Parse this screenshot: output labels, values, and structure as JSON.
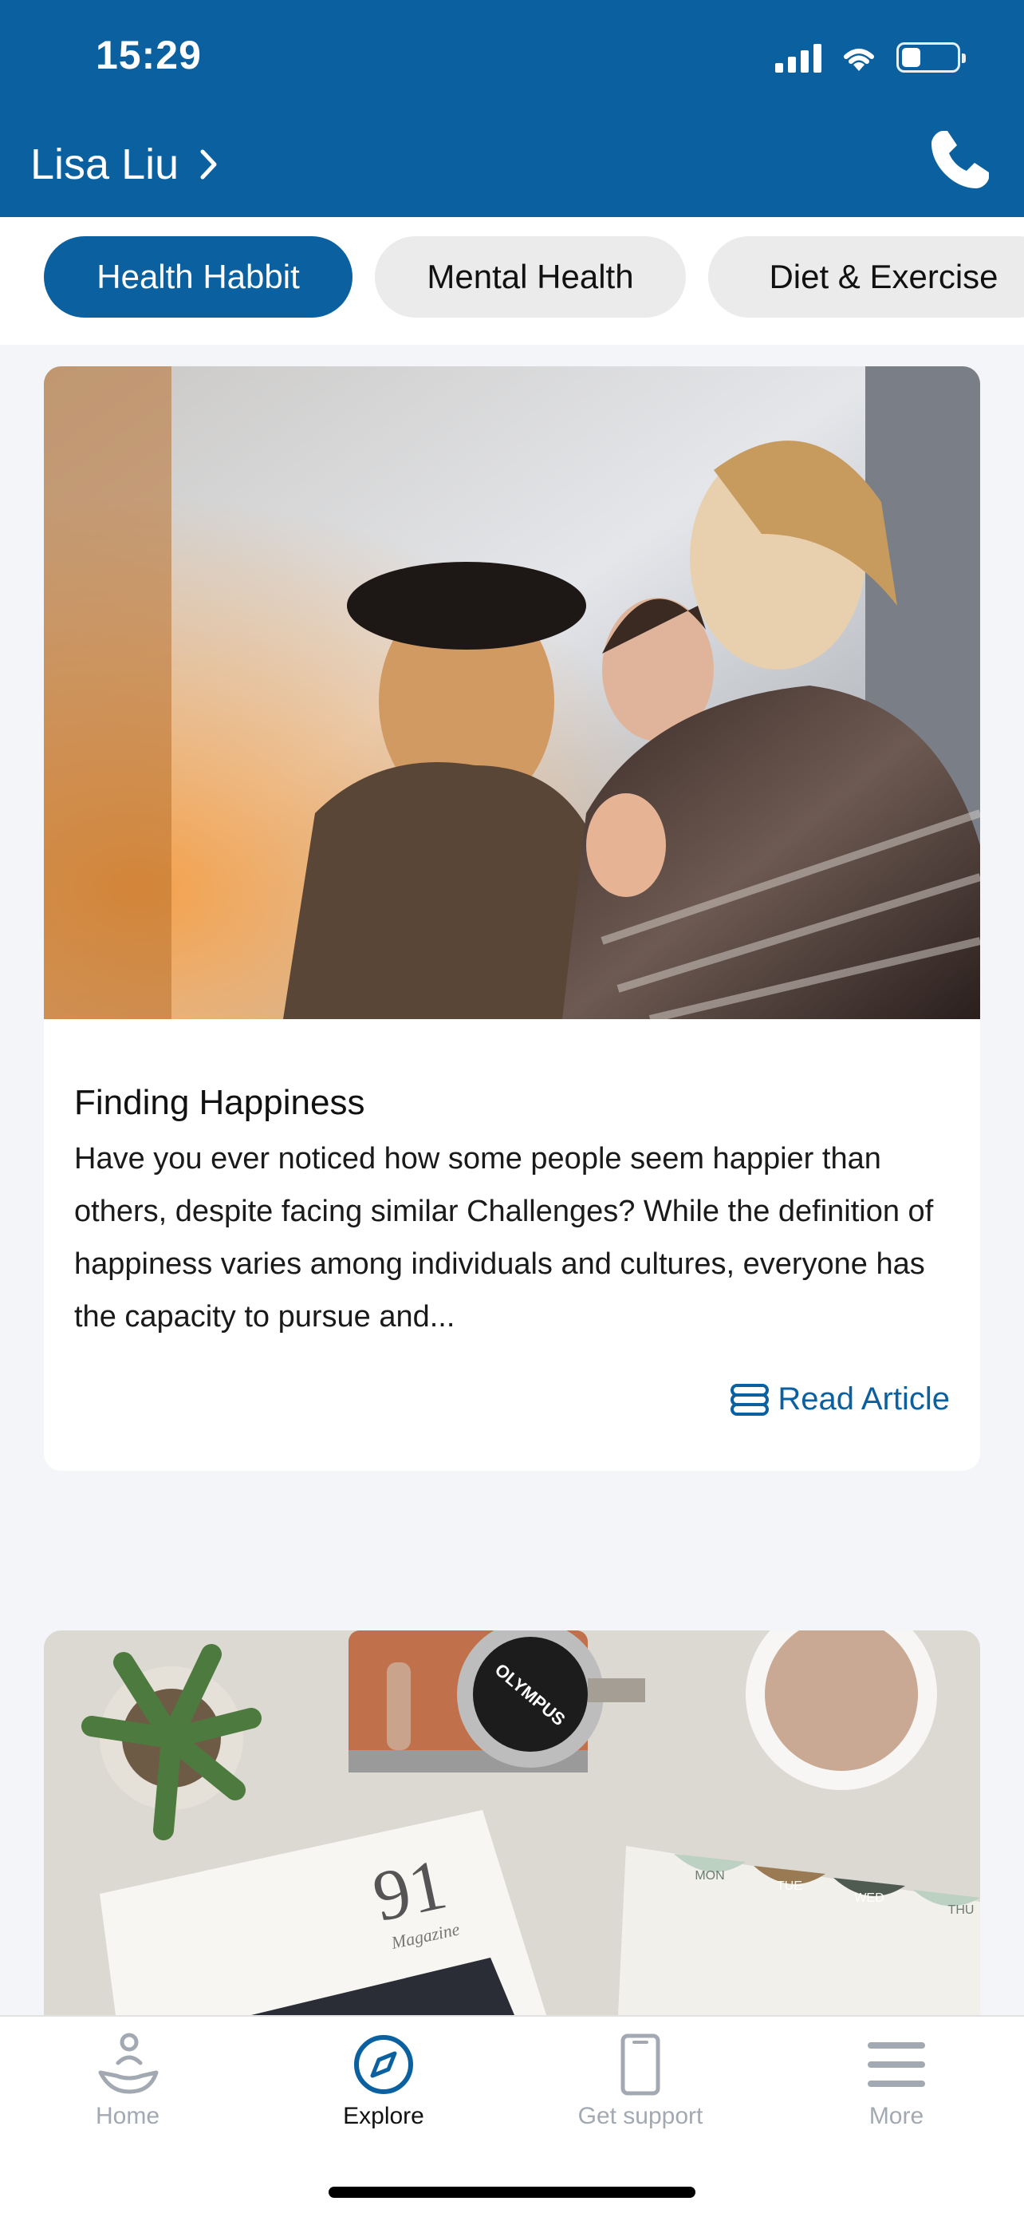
{
  "status_bar": {
    "time": "15:29",
    "battery_level": 0.3
  },
  "header": {
    "user_name": "Lisa Liu",
    "chevron_icon": "chevron-right-icon",
    "call_icon": "phone-icon"
  },
  "tabs": [
    {
      "label": "Health Habbit",
      "active": true
    },
    {
      "label": "Mental Health",
      "active": false
    },
    {
      "label": "Diet & Exercise",
      "active": false
    }
  ],
  "articles": [
    {
      "image": "friends-laughing-photo",
      "title": "Finding Happiness",
      "excerpt": "Have you ever noticed how some people seem happier than others, despite facing similar Challenges? While the definition of happiness varies among individuals and cultures, everyone has the capacity to pursue and...",
      "link_label": "Read Article",
      "link_icon": "article-icon"
    },
    {
      "image": "desk-flatlay-photo",
      "camera_brand": "OLYMPUS",
      "magazine_number": "91",
      "magazine_word": "Magazine",
      "calendar_days": [
        "MON",
        "TUE",
        "WED",
        "THU"
      ]
    }
  ],
  "bottom_nav": [
    {
      "label": "Home",
      "icon": "hand-leaf-icon",
      "active": false
    },
    {
      "label": "Explore",
      "icon": "compass-icon",
      "active": true
    },
    {
      "label": "Get support",
      "icon": "phone-device-icon",
      "active": false
    },
    {
      "label": "More",
      "icon": "menu-icon",
      "active": false
    }
  ],
  "colors": {
    "primary": "#0b61a0",
    "background": "#f3f5f8",
    "inactive_nav": "#a3a9b2"
  }
}
